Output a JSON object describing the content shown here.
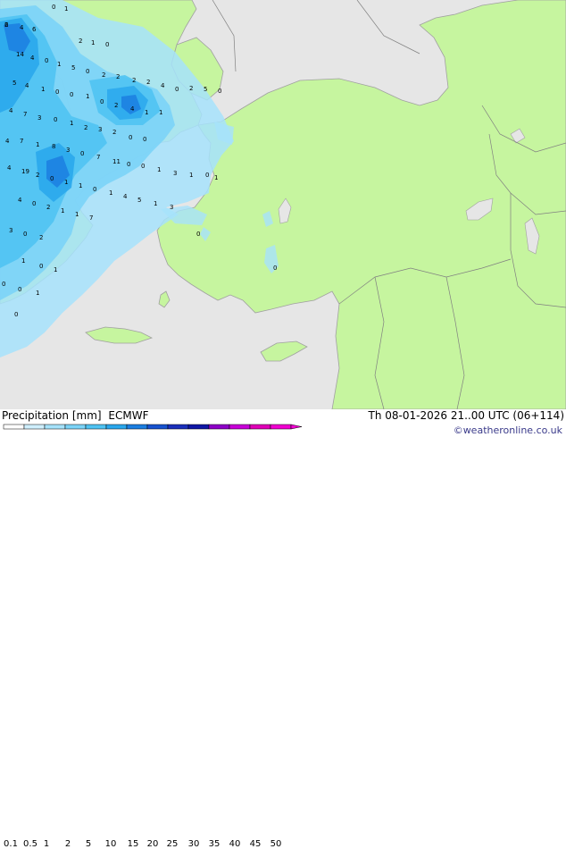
{
  "title": "Precipitation [mm]",
  "model": "ECMWF",
  "valid_time": "Th 08-01-2026 21..00 UTC (06+114)",
  "credit": "©weatheronline.co.uk",
  "colors": {
    "sea": "#e6e6e6",
    "land": "#c6f59f",
    "coast": "#a0a0a0",
    "border": "#808080"
  },
  "legend": {
    "ticks": [
      "0.1",
      "0.5",
      "1",
      "2",
      "5",
      "10",
      "15",
      "20",
      "25",
      "30",
      "35",
      "40",
      "45",
      "50"
    ],
    "colors": [
      "#ffffff",
      "#cfeffd",
      "#a6e2fb",
      "#7bd3f7",
      "#4fc3f2",
      "#2aa7ec",
      "#1b7ee0",
      "#1752cf",
      "#1a2fbb",
      "#0f17a6",
      "#8e00c8",
      "#c800d8",
      "#e000b8",
      "#f000d0"
    ]
  },
  "map_labels": [
    "6",
    "4",
    "6",
    "0",
    "1",
    "2",
    "1",
    "0",
    "14",
    "4",
    "0",
    "1",
    "5",
    "0",
    "2",
    "2",
    "2",
    "2",
    "4",
    "5",
    "4",
    "1",
    "0",
    "0",
    "1",
    "0",
    "2",
    "4",
    "1",
    "1",
    "0",
    "2",
    "5",
    "0",
    "4",
    "7",
    "3",
    "0",
    "1",
    "2",
    "3",
    "2",
    "0",
    "0",
    "4",
    "7",
    "1",
    "8",
    "3",
    "0",
    "7",
    "11",
    "0",
    "0",
    "1",
    "3",
    "1",
    "0",
    "1",
    "4",
    "19",
    "2",
    "0",
    "1",
    "1",
    "0",
    "1",
    "4",
    "5",
    "1",
    "3",
    "4",
    "0",
    "2",
    "1",
    "1",
    "7",
    "3",
    "0",
    "2",
    "0",
    "1",
    "0",
    "1",
    "0",
    "0",
    "1",
    "0",
    "0",
    "2"
  ]
}
